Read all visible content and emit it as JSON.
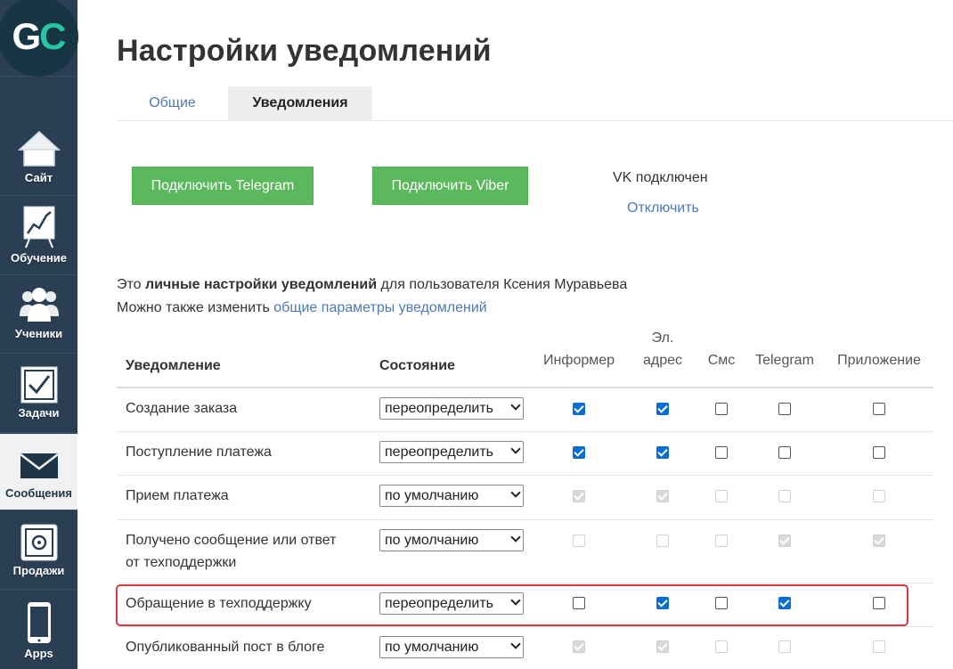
{
  "logo": {
    "g": "G",
    "c": "C"
  },
  "sidebar": {
    "items": [
      {
        "label": "Сайт",
        "icon": "home-icon"
      },
      {
        "label": "Обучение",
        "icon": "chart-board-icon"
      },
      {
        "label": "Ученики",
        "icon": "users-icon"
      },
      {
        "label": "Задачи",
        "icon": "checkbox-icon"
      },
      {
        "label": "Сообщения",
        "icon": "envelope-icon",
        "active": true
      },
      {
        "label": "Продажи",
        "icon": "safe-icon"
      },
      {
        "label": "Apps",
        "icon": "phone-icon"
      }
    ]
  },
  "page": {
    "title": "Настройки уведомлений"
  },
  "tabs": [
    {
      "label": "Общие"
    },
    {
      "label": "Уведомления",
      "active": true
    }
  ],
  "connect": {
    "telegram_button": "Подключить Telegram",
    "viber_button": "Подключить Viber",
    "vk_status": "VK подключен",
    "vk_disconnect": "Отключить"
  },
  "info": {
    "line1_prefix": "Это ",
    "line1_bold": "личные настройки уведомлений",
    "line1_suffix": " для пользователя Ксения Муравьева",
    "line2_prefix": "Можно также изменить ",
    "line2_link": "общие параметры уведомлений"
  },
  "table": {
    "headers": {
      "notification": "Уведомление",
      "state": "Состояние",
      "informer": "Информер",
      "email_line1": "Эл.",
      "email_line2": "адрес",
      "sms": "Смс",
      "telegram": "Telegram",
      "app": "Приложение"
    },
    "rows": [
      {
        "name": "Создание заказа",
        "state": "переопределить",
        "checks": [
          true,
          true,
          false,
          false,
          false
        ],
        "disabled": false
      },
      {
        "name": "Поступление платежа",
        "state": "переопределить",
        "checks": [
          true,
          true,
          false,
          false,
          false
        ],
        "disabled": false
      },
      {
        "name": "Прием платежа",
        "state": "по умолчанию",
        "checks": [
          true,
          true,
          false,
          false,
          false
        ],
        "disabled": true
      },
      {
        "name_line1": "Получено сообщение или ответ",
        "name_line2": "от техподдержки",
        "state": "по умолчанию",
        "checks": [
          false,
          false,
          false,
          true,
          true
        ],
        "disabled": true
      },
      {
        "name": "Обращение в техподдержку",
        "state": "переопределить",
        "checks": [
          false,
          true,
          false,
          true,
          false
        ],
        "disabled": false,
        "highlighted": true
      },
      {
        "name": "Опубликованный пост в блоге",
        "state": "по умолчанию",
        "checks": [
          true,
          true,
          false,
          false,
          false
        ],
        "disabled": true
      }
    ]
  },
  "colors": {
    "sidebar": "#2a3f54",
    "accent_green": "#5cb85c",
    "link": "#4c7ab4",
    "highlight": "#d9383f",
    "checkbox": "#0a6cd6"
  }
}
